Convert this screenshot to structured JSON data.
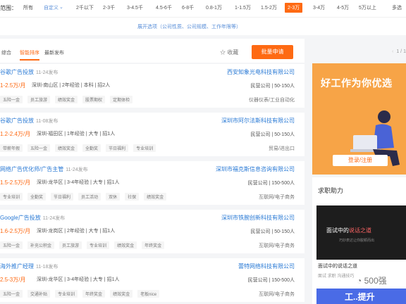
{
  "filter": {
    "label": "范围：",
    "options": [
      "所有",
      "自定义",
      "2千以下",
      "2-3千",
      "3-4.5千",
      "4.5-6千",
      "6-8千",
      "0.8-1万",
      "1-1.5万",
      "1.5-2万",
      "2-3万",
      "3-4万",
      "4-5万",
      "5万以上",
      "多选"
    ],
    "selected_index": 10,
    "expand_link": "展开选项（公司性质、公司规模、工作年限等）"
  },
  "sort": {
    "tabs": [
      "综合",
      "智能排序",
      "最新发布"
    ],
    "active_index": 1,
    "favorite_label": "收藏",
    "batch_button": "批量申请",
    "page_indicator": "1 / 1"
  },
  "jobs": [
    {
      "title": "谷歌广告投放",
      "date": "11-24发布",
      "salary": "1-2.5万/月",
      "requirements": "深圳-南山区 | 2年经验 | 本科 | 招2人",
      "tags": [
        "五险一金",
        "员工旅游",
        "绩效奖金",
        "股票期权",
        "定期体检"
      ],
      "company": "西安知象光电科技有限公司",
      "company_info": "民营公司 | 50-150人",
      "industry": "仪器仪表/工业自动化"
    },
    {
      "title": "谷歌广告投放",
      "date": "11-08发布",
      "salary": "1.2-2.4万/月",
      "requirements": "深圳-福田区 | 1年经验 | 大专 | 招1人",
      "tags": [
        "带薪年假",
        "五险一金",
        "绩效奖金",
        "全勤奖",
        "节日福利",
        "专业培训"
      ],
      "company": "深圳市阿尔法斯科技有限公司",
      "company_info": "民营公司 | 50-150人",
      "industry": "贸易/进出口"
    },
    {
      "title": "网络广告优化师/广告主管",
      "date": "11-24发布",
      "salary": "1.5-2.5万/月",
      "requirements": "深圳-龙华区 | 3-4年经验 | 大专 | 招1人",
      "tags": [
        "专业培训",
        "全勤奖",
        "节日福利",
        "员工活动",
        "双休",
        "社保",
        "绩效奖金"
      ],
      "company": "深圳市福克斯信息咨询有限公司",
      "company_info": "民营公司 | 150-500人",
      "industry": "互联网/电子商务"
    },
    {
      "title": "Google广告投放",
      "date": "11-24发布",
      "salary": "1.6-2.5万/月",
      "requirements": "深圳-龙岗区 | 2年经验 | 大专 | 招1人",
      "tags": [
        "五险一金",
        "补充公积金",
        "员工旅游",
        "专业培训",
        "绩效奖金",
        "年终奖金"
      ],
      "company": "深圳市铁腕创新科技有限公司",
      "company_info": "民营公司 | 50-150人",
      "industry": "互联网/电子商务"
    },
    {
      "title": "海外推广经理",
      "date": "11-18发布",
      "salary": "2.5-3万/月",
      "requirements": "深圳-龙华区 | 3-4年经验 | 大专 | 招1人",
      "tags": [
        "五险一金",
        "交通补贴",
        "专业培训",
        "年终奖金",
        "绩效奖金",
        "老板nice"
      ],
      "company": "蕾特网络科技有限公司",
      "company_info": "民营公司 | 150-500人",
      "industry": "互联网/电子商务"
    }
  ],
  "banner": {
    "headline": "好工作为你优选",
    "login_button": "登录/注册"
  },
  "help": {
    "title": "求职助力",
    "card_text_prefix": "面试中的",
    "card_text_highlight": "说话之道",
    "card_subtitle": "巧妙表达让你脱颖而出",
    "caption": "面试中的说话之道",
    "meta": "面试  求职  沟通技巧",
    "card2_text": "工..提升"
  },
  "watermark": "500强",
  "colors": {
    "accent": "#fe6a13",
    "link": "#2a7ad5"
  }
}
